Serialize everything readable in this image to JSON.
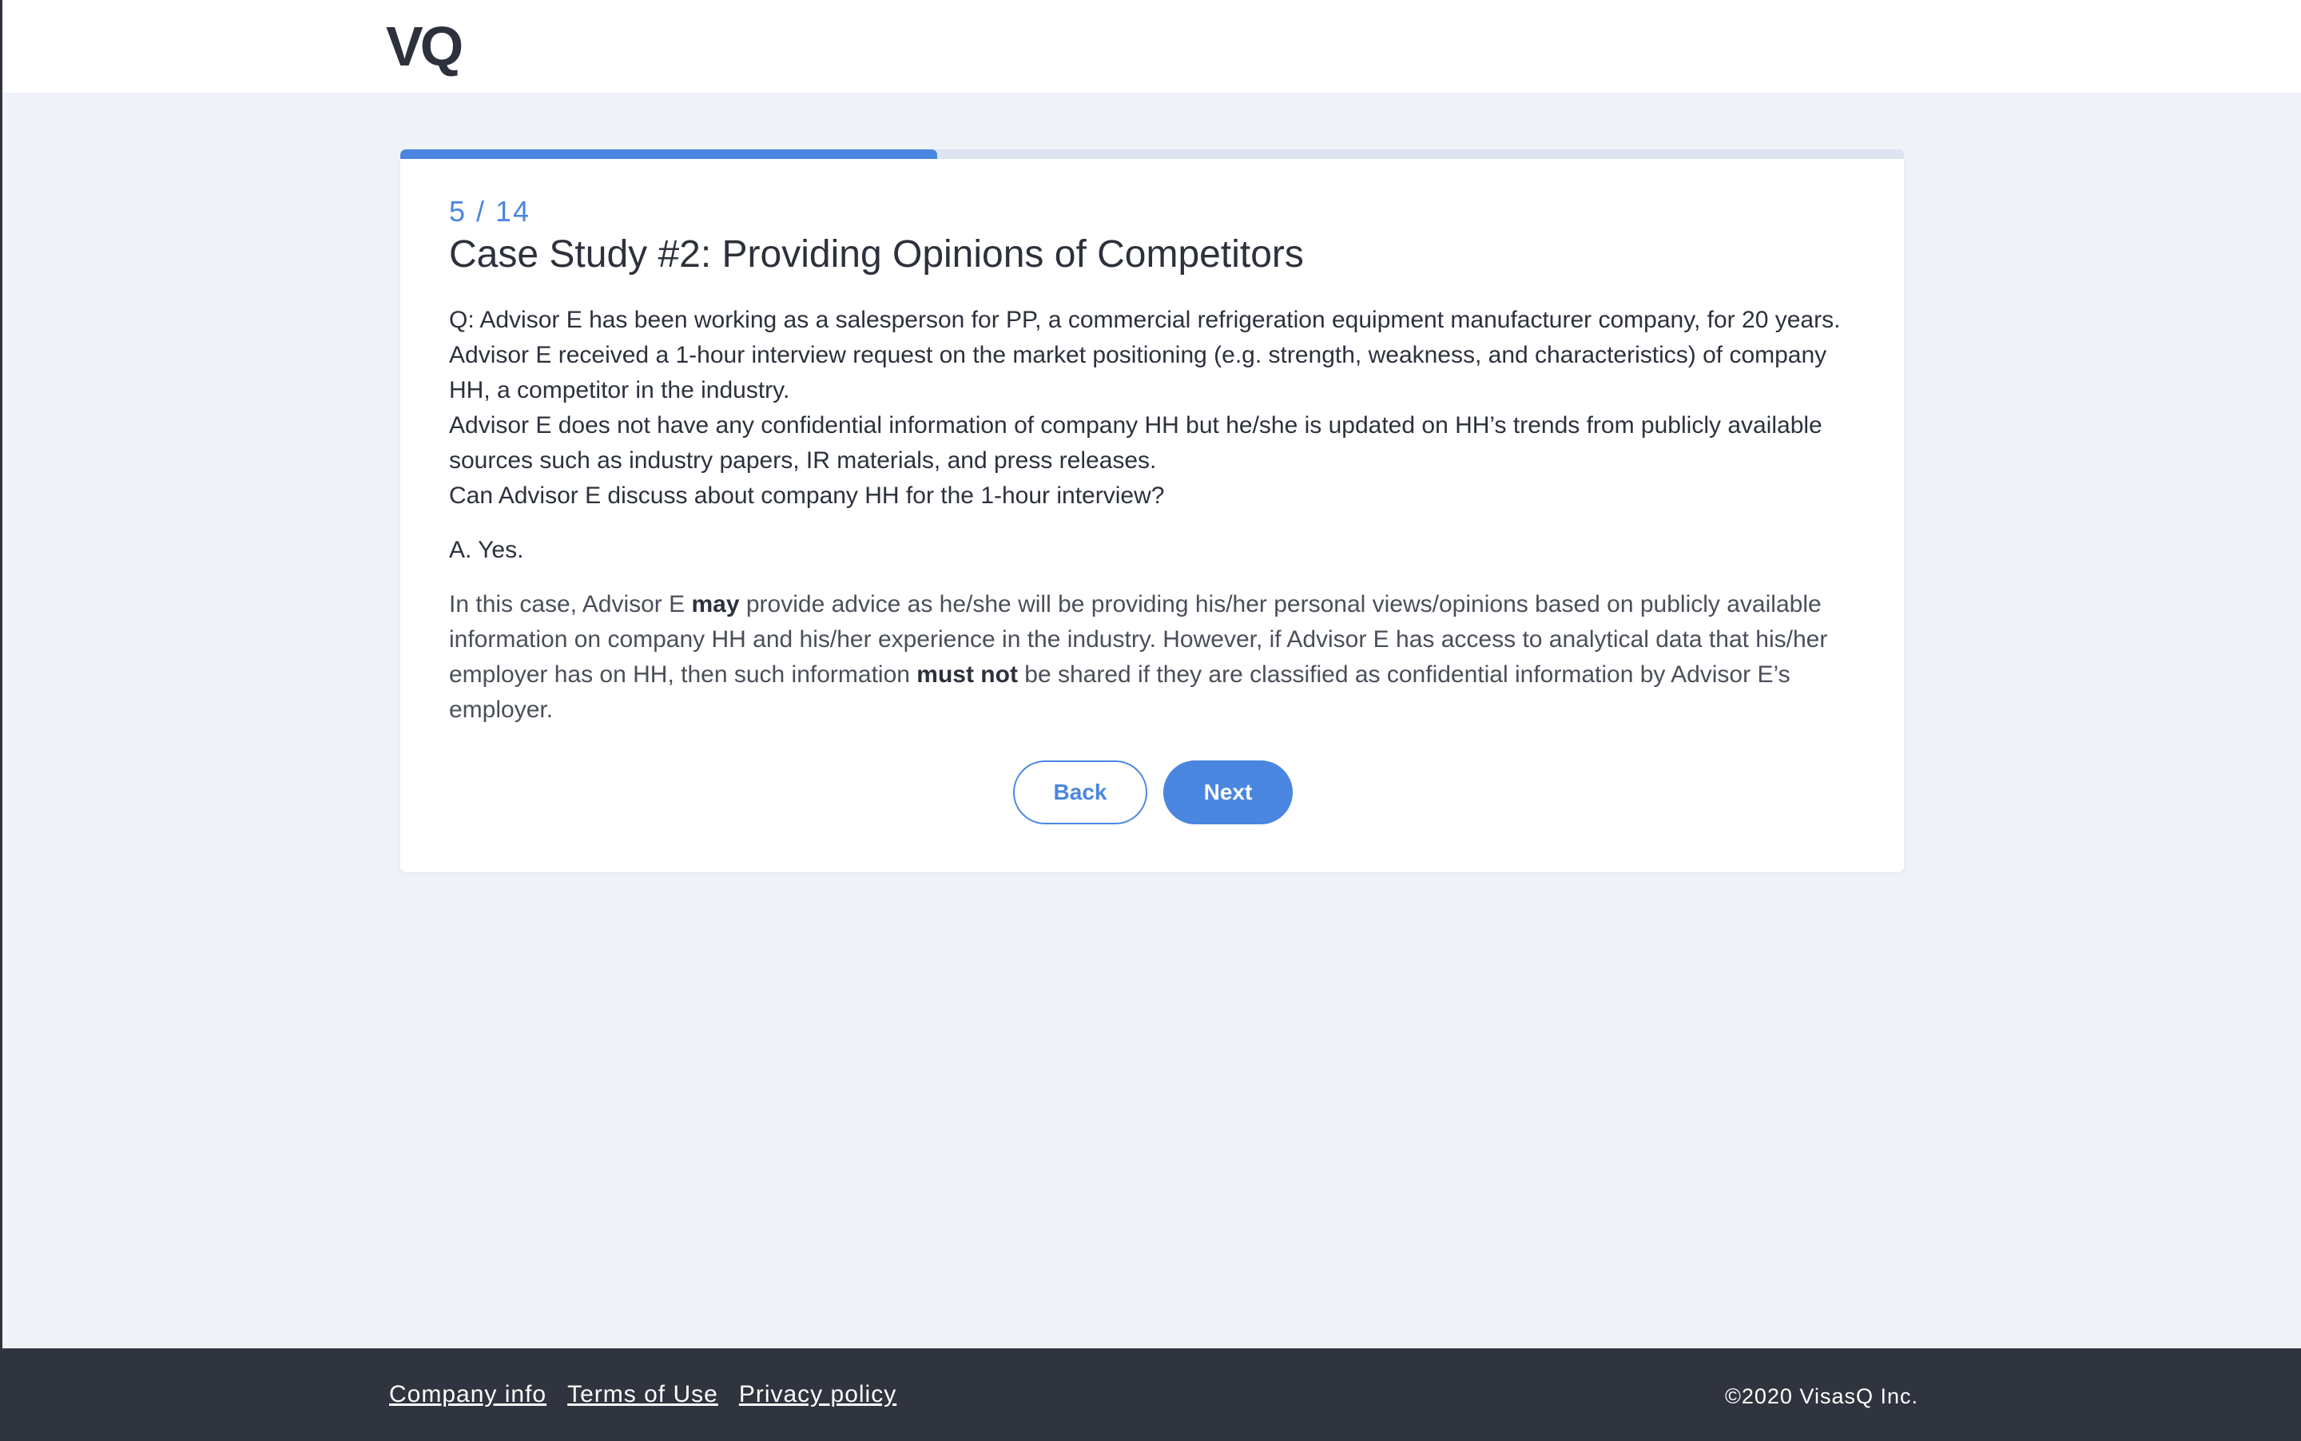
{
  "brand": {
    "logo_text": "VQ"
  },
  "progress": {
    "current": 5,
    "total": 14,
    "label": "5 / 14",
    "fill_fraction": 0.357
  },
  "card": {
    "title": "Case Study #2: Providing Opinions of Competitors",
    "question_lines": [
      "Q: Advisor E has been working as a salesperson for PP, a commercial refrigeration equipment manufacturer company, for 20 years. Advisor E received a 1-hour interview request on the market positioning (e.g. strength, weakness, and characteristics) of company HH, a competitor in the industry.",
      "Advisor E does not have any confidential information of company HH but he/she is updated on HH’s trends from publicly available sources such as industry papers, IR materials, and press releases.",
      "Can Advisor E discuss about company HH for the 1-hour interview?"
    ],
    "answer": "A. Yes.",
    "explanation": {
      "part1": "In this case, Advisor E ",
      "bold1": "may",
      "part2": " provide advice as he/she will be providing his/her personal views/opinions based on publicly available information on company HH and his/her experience in the industry. However, if Advisor E has access to analytical data that his/her employer has on HH, then such information ",
      "bold2": "must not",
      "part3": " be shared if they are classified as confidential information by Advisor E’s employer."
    },
    "buttons": {
      "back": "Back",
      "next": "Next"
    }
  },
  "footer": {
    "links": [
      "Company info",
      "Terms of Use",
      "Privacy policy"
    ],
    "copyright": "©2020 VisasQ Inc."
  },
  "colors": {
    "accent": "#4a86e0",
    "page_bg": "#eff3f8",
    "footer_bg": "#2f343e",
    "text_dark": "#2c313c"
  }
}
